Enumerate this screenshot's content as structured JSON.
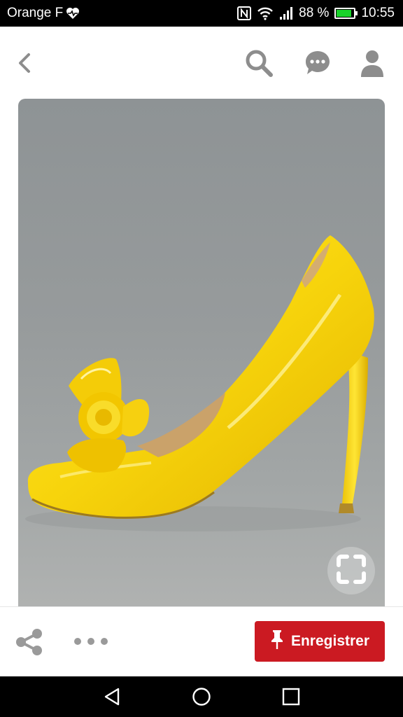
{
  "status_bar": {
    "carrier": "Orange F",
    "battery_percent": "88 %",
    "battery_level": 0.88,
    "time": "10:55",
    "icons": [
      "heart-pulse-icon",
      "nfc-icon",
      "wifi-icon",
      "signal-icon",
      "battery-charging-icon"
    ]
  },
  "app_bar": {
    "icons": [
      "back-icon",
      "search-icon",
      "messages-icon",
      "profile-icon"
    ]
  },
  "pin": {
    "expand_icon": "expand-icon"
  },
  "action_bar": {
    "save_label": "Enregistrer",
    "save_color": "#cb1a22",
    "icons": [
      "share-icon",
      "more-icon",
      "pushpin-icon"
    ]
  },
  "nav_bar": {
    "icons": [
      "nav-back-icon",
      "nav-home-icon",
      "nav-recents-icon"
    ]
  }
}
